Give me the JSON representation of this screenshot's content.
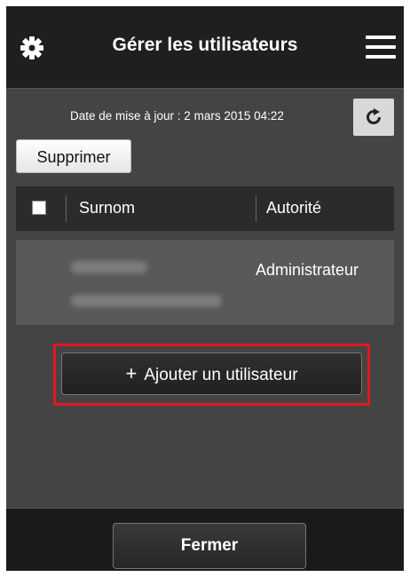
{
  "header": {
    "title": "Gérer les utilisateurs",
    "settings_icon": "gear-icon",
    "menu_icon": "hamburger-menu-icon"
  },
  "update": {
    "text": "Date de mise à jour : 2 mars 2015 04:22",
    "refresh_icon": "refresh-icon"
  },
  "actions": {
    "delete_label": "Supprimer",
    "add_user_label": "Ajouter un utilisateur",
    "add_icon": "plus-icon"
  },
  "table": {
    "columns": [
      "Surnom",
      "Autorité"
    ],
    "rows": [
      {
        "authority": "Administrateur"
      }
    ]
  },
  "footer": {
    "close_label": "Fermer"
  },
  "colors": {
    "highlight": "#e0181f",
    "background": "#444444",
    "header": "#1f1f1f"
  }
}
